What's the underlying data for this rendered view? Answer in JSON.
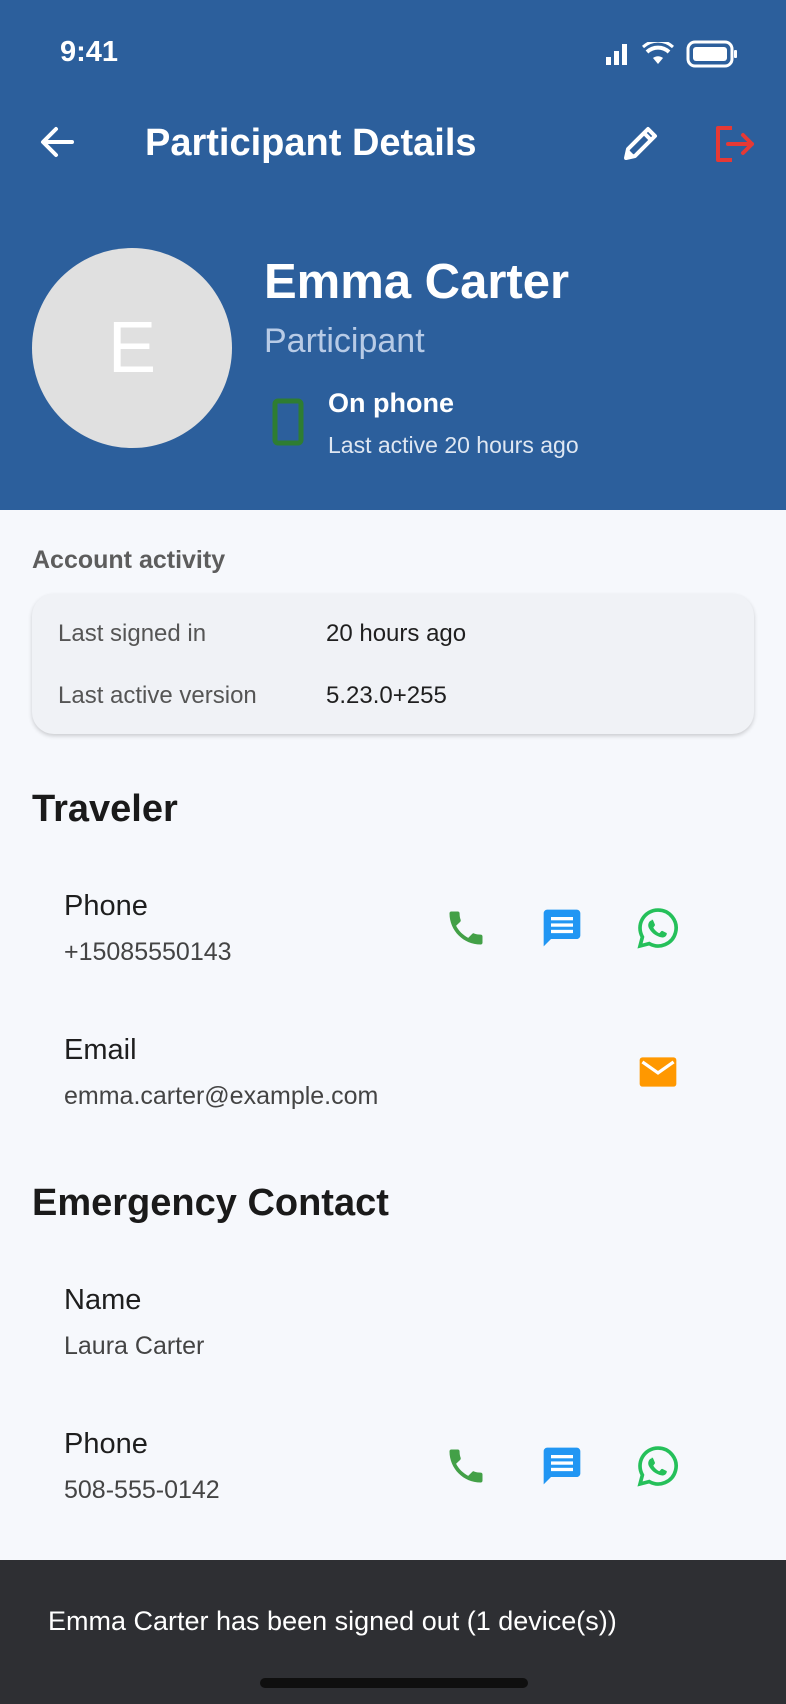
{
  "status_bar": {
    "time": "9:41"
  },
  "appbar": {
    "title": "Participant Details"
  },
  "profile": {
    "initial": "E",
    "name": "Emma Carter",
    "role": "Participant",
    "device_status": "On phone",
    "device_last_active": "Last active 20 hours ago"
  },
  "account_activity": {
    "caption": "Account activity",
    "rows": [
      {
        "label": "Last signed in",
        "value": "20 hours ago"
      },
      {
        "label": "Last active version",
        "value": "5.23.0+255"
      }
    ]
  },
  "traveler": {
    "title": "Traveler",
    "phone": {
      "label": "Phone",
      "value": "+15085550143"
    },
    "email": {
      "label": "Email",
      "value": "emma.carter@example.com"
    }
  },
  "emergency_contact": {
    "title": "Emergency Contact",
    "name": {
      "label": "Name",
      "value": "Laura Carter"
    },
    "phone": {
      "label": "Phone",
      "value": "508-555-0142"
    }
  },
  "snackbar": {
    "message": "Emma Carter has been signed out (1 device(s))"
  },
  "icons": {
    "call": "phone-icon",
    "sms": "message-icon",
    "whatsapp": "whatsapp-icon",
    "email": "email-icon"
  },
  "colors": {
    "header": "#2c5f9c",
    "call": "#43a047",
    "sms": "#2196f3",
    "whatsapp": "#25c05a",
    "email": "#ff9800",
    "logout": "#e53935",
    "device": "#2e7d32"
  }
}
